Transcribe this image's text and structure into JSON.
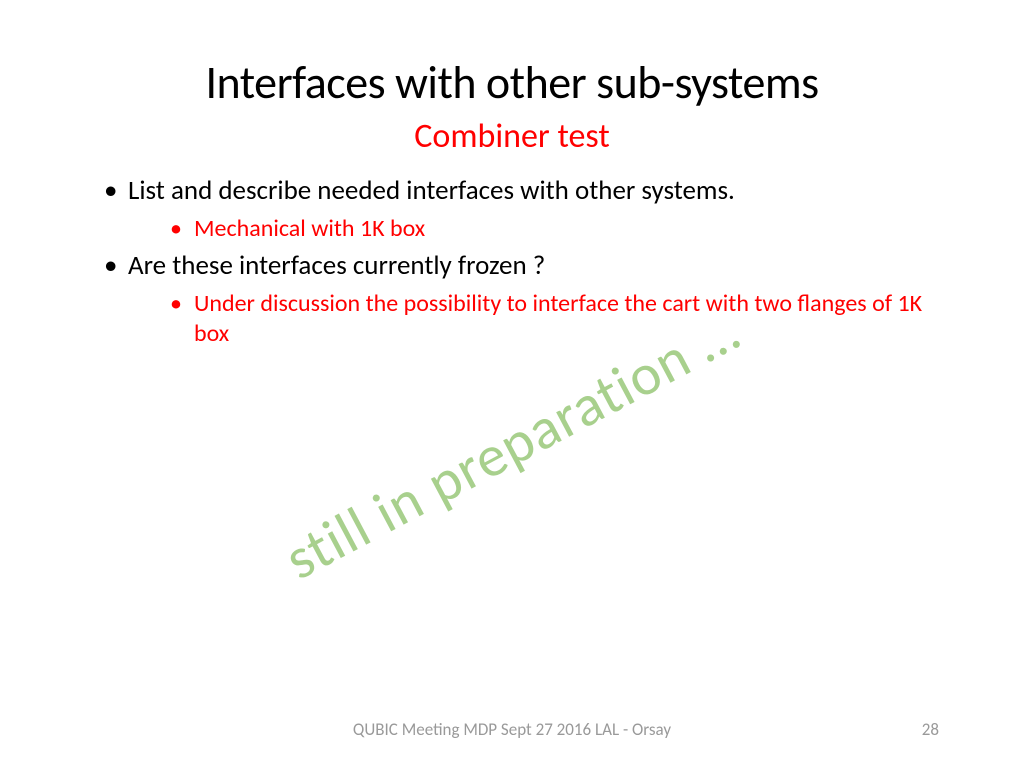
{
  "title": "Interfaces with other sub-systems",
  "subtitle": "Combiner test",
  "bullets": [
    {
      "text": "List and describe needed interfaces with other systems.",
      "children": [
        "Mechanical with 1K box"
      ]
    },
    {
      "text": "Are these interfaces currently frozen ?",
      "children": [
        "Under discussion the possibility to interface the cart with two flanges of 1K box"
      ]
    }
  ],
  "watermark": "still in preparation …",
  "footer": {
    "text": "QUBIC Meeting MDP Sept 27 2016 LAL - Orsay",
    "page": "28"
  }
}
